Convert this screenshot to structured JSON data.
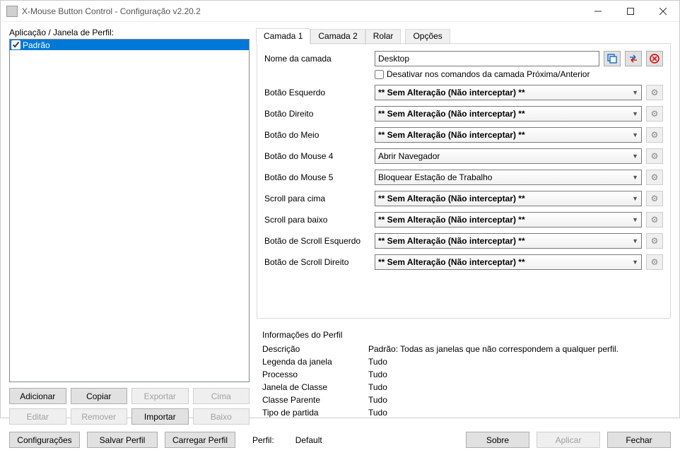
{
  "title": "X-Mouse Button Control - Configuração v2.20.2",
  "leftPanel": {
    "label": "Aplicação / Janela de Perfil:",
    "items": [
      {
        "name": "Padrão",
        "checked": true
      }
    ],
    "buttons": {
      "add": "Adicionar",
      "copy": "Copiar",
      "export": "Exportar",
      "up": "Cima",
      "edit": "Editar",
      "remove": "Remover",
      "import": "Importar",
      "down": "Baixo"
    }
  },
  "tabs": {
    "layer1": "Camada 1",
    "layer2": "Camada 2",
    "scroll": "Rolar",
    "options": "Opções"
  },
  "layer": {
    "nameLabel": "Nome da camada",
    "nameValue": "Desktop",
    "disableCheckbox": "Desativar nos comandos da camada Próxima/Anterior",
    "noChange": "** Sem Alteração (Não interceptar) **",
    "rows": {
      "left": "Botão Esquerdo",
      "right": "Botão Direito",
      "middle": "Botão do Meio",
      "m4": "Botão do Mouse 4",
      "m4val": "Abrir Navegador",
      "m5": "Botão do Mouse 5",
      "m5val": "Bloquear Estação de Trabalho",
      "wheelUp": "Scroll para cima",
      "wheelDown": "Scroll para baixo",
      "tiltLeft": "Botão de Scroll Esquerdo",
      "tiltRight": "Botão de Scroll Direito"
    }
  },
  "info": {
    "title": "Informações do Perfil",
    "descLabel": "Descrição",
    "desc": "Padrão: Todas as janelas que não correspondem a qualquer perfil.",
    "captionLabel": "Legenda da janela",
    "caption": "Tudo",
    "processLabel": "Processo",
    "process": "Tudo",
    "classLabel": "Janela de Classe",
    "class": "Tudo",
    "parentLabel": "Classe Parente",
    "parent": "Tudo",
    "matchLabel": "Tipo de partida",
    "match": "Tudo"
  },
  "bottom": {
    "settings": "Configurações",
    "save": "Salvar Perfil",
    "load": "Carregar Perfil",
    "profileLabel": "Perfil:",
    "profileName": "Default",
    "about": "Sobre",
    "apply": "Aplicar",
    "close": "Fechar"
  }
}
